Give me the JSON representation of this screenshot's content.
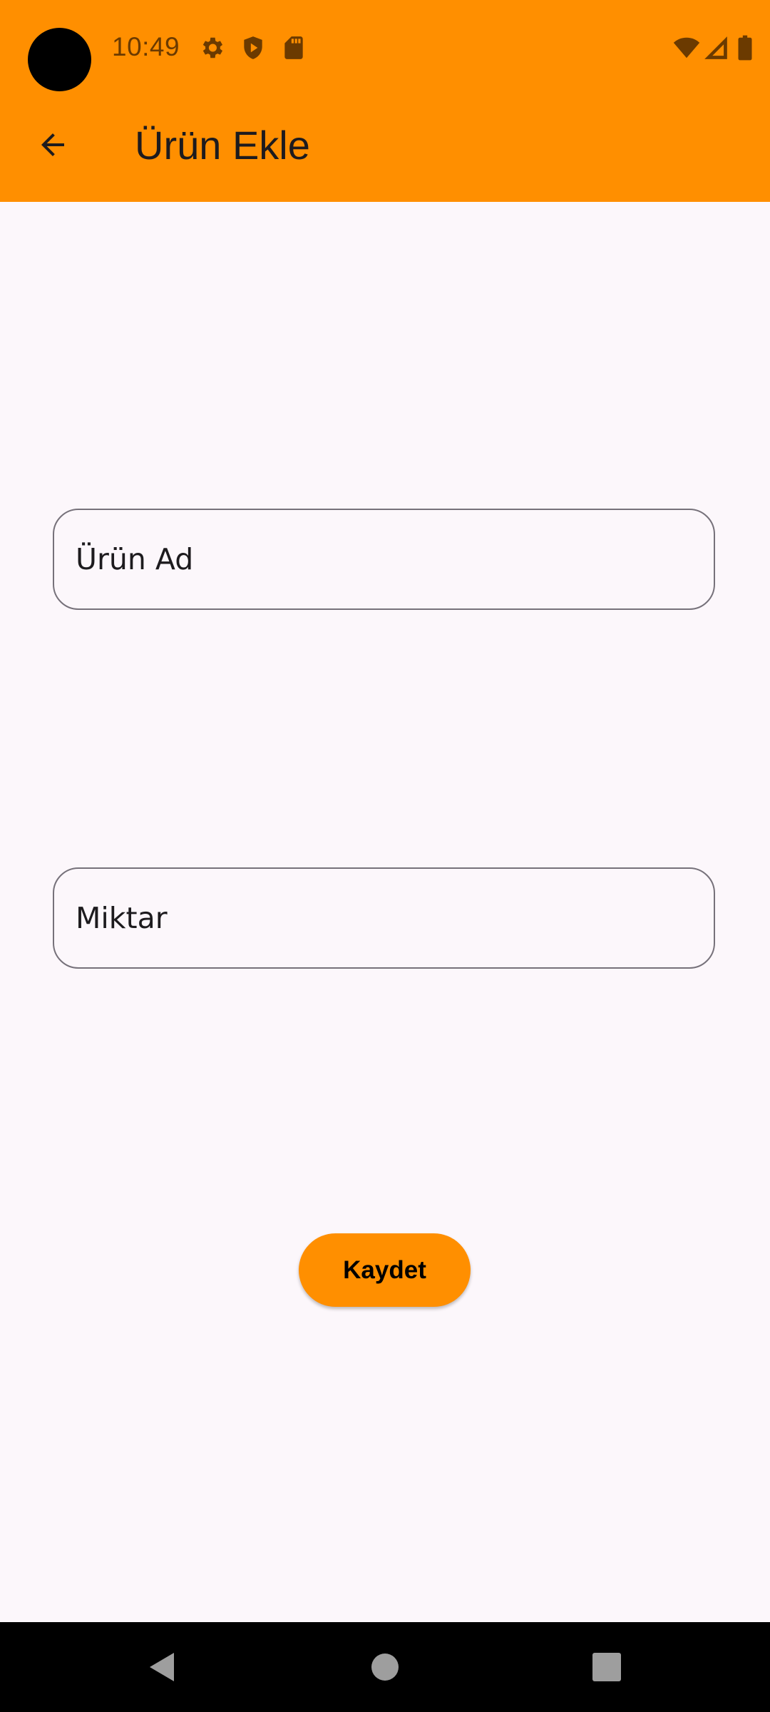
{
  "status_bar": {
    "time": "10:49",
    "icons": [
      "settings-gear-icon",
      "shield-play-icon",
      "sd-card-icon",
      "wifi-icon",
      "cell-signal-icon",
      "battery-icon"
    ]
  },
  "app_bar": {
    "back_icon": "arrow-back-icon",
    "title": "Ürün Ekle"
  },
  "form": {
    "product_name": {
      "placeholder": "Ürün Ad",
      "value": ""
    },
    "quantity": {
      "placeholder": "Miktar",
      "value": ""
    },
    "save_label": "Kaydet"
  },
  "nav_bar": {
    "icons": [
      "nav-back-icon",
      "nav-home-icon",
      "nav-recents-icon"
    ]
  },
  "colors": {
    "accent": "#ff8f00",
    "background": "#fcf7fb",
    "status_icons": "#6b3a00",
    "outline": "#76717a",
    "text": "#1d1b1e"
  }
}
